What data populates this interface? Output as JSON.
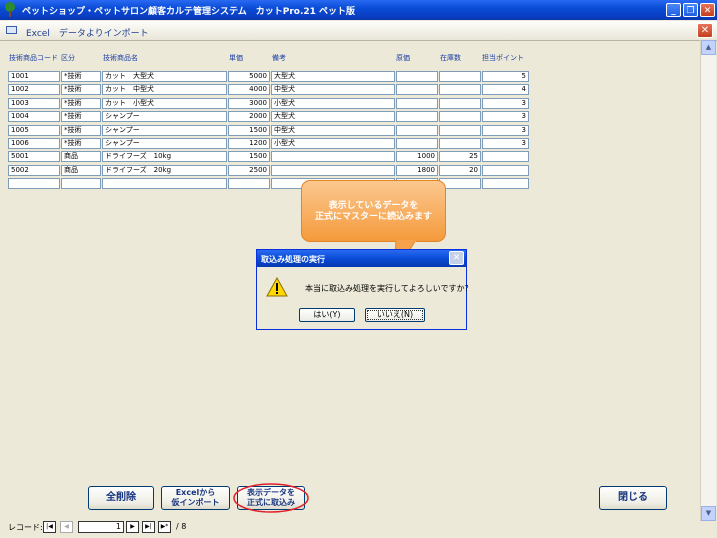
{
  "window": {
    "title": "ペットショップ・ペットサロン顧客カルテ管理システム　カットPro.21 ペット版"
  },
  "form": {
    "title": "Excel　データよりインポート"
  },
  "headers": {
    "code": "技術商品コード",
    "kubun": "区分",
    "name": "技術商品名",
    "price": "単価",
    "note": "備考",
    "cost": "原価",
    "stock": "在庫数",
    "points": "担当ポイント"
  },
  "rows": [
    {
      "code": "1001",
      "kubun": "*技術",
      "name": "カット　大型犬",
      "price": "5000",
      "note": "大型犬",
      "cost": "",
      "stock": "",
      "points": "5"
    },
    {
      "code": "1002",
      "kubun": "*技術",
      "name": "カット　中型犬",
      "price": "4000",
      "note": "中型犬",
      "cost": "",
      "stock": "",
      "points": "4"
    },
    {
      "code": "1003",
      "kubun": "*技術",
      "name": "カット　小型犬",
      "price": "3000",
      "note": "小型犬",
      "cost": "",
      "stock": "",
      "points": "3"
    },
    {
      "code": "1004",
      "kubun": "*技術",
      "name": "シャンプー",
      "price": "2000",
      "note": "大型犬",
      "cost": "",
      "stock": "",
      "points": "3"
    },
    {
      "code": "1005",
      "kubun": "*技術",
      "name": "シャンプー",
      "price": "1500",
      "note": "中型犬",
      "cost": "",
      "stock": "",
      "points": "3"
    },
    {
      "code": "1006",
      "kubun": "*技術",
      "name": "シャンプー",
      "price": "1200",
      "note": "小型犬",
      "cost": "",
      "stock": "",
      "points": "3"
    },
    {
      "code": "5001",
      "kubun": "商品",
      "name": "ドライフーズ　10kg",
      "price": "1500",
      "note": "",
      "cost": "1000",
      "stock": "25",
      "points": ""
    },
    {
      "code": "5002",
      "kubun": "商品",
      "name": "ドライフーズ　20kg",
      "price": "2500",
      "note": "",
      "cost": "1800",
      "stock": "20",
      "points": ""
    },
    {
      "code": "",
      "kubun": "",
      "name": "",
      "price": "",
      "note": "",
      "cost": "",
      "stock": "",
      "points": ""
    }
  ],
  "callout": {
    "line1": "表示しているデータを",
    "line2": "正式にマスターに読込みます"
  },
  "dialog": {
    "title": "取込み処理の実行",
    "message": "本当に取込み処理を実行してよろしいですか？",
    "yes": "はい(Y)",
    "no": "いいえ(N)"
  },
  "buttons": {
    "delete_all": "全削除",
    "excel_import": "Excelから\n仮インポート",
    "commit_import": "表示データを\n正式に取込み",
    "close": "閉じる"
  },
  "record_nav": {
    "label": "レコード:",
    "current": "1",
    "total": "/ 8"
  },
  "colors": {
    "titlebar": "#0a4cd6",
    "callout": "#f59a3c",
    "header_text": "#1c3fa4",
    "highlight_ring": "#e0202a"
  }
}
